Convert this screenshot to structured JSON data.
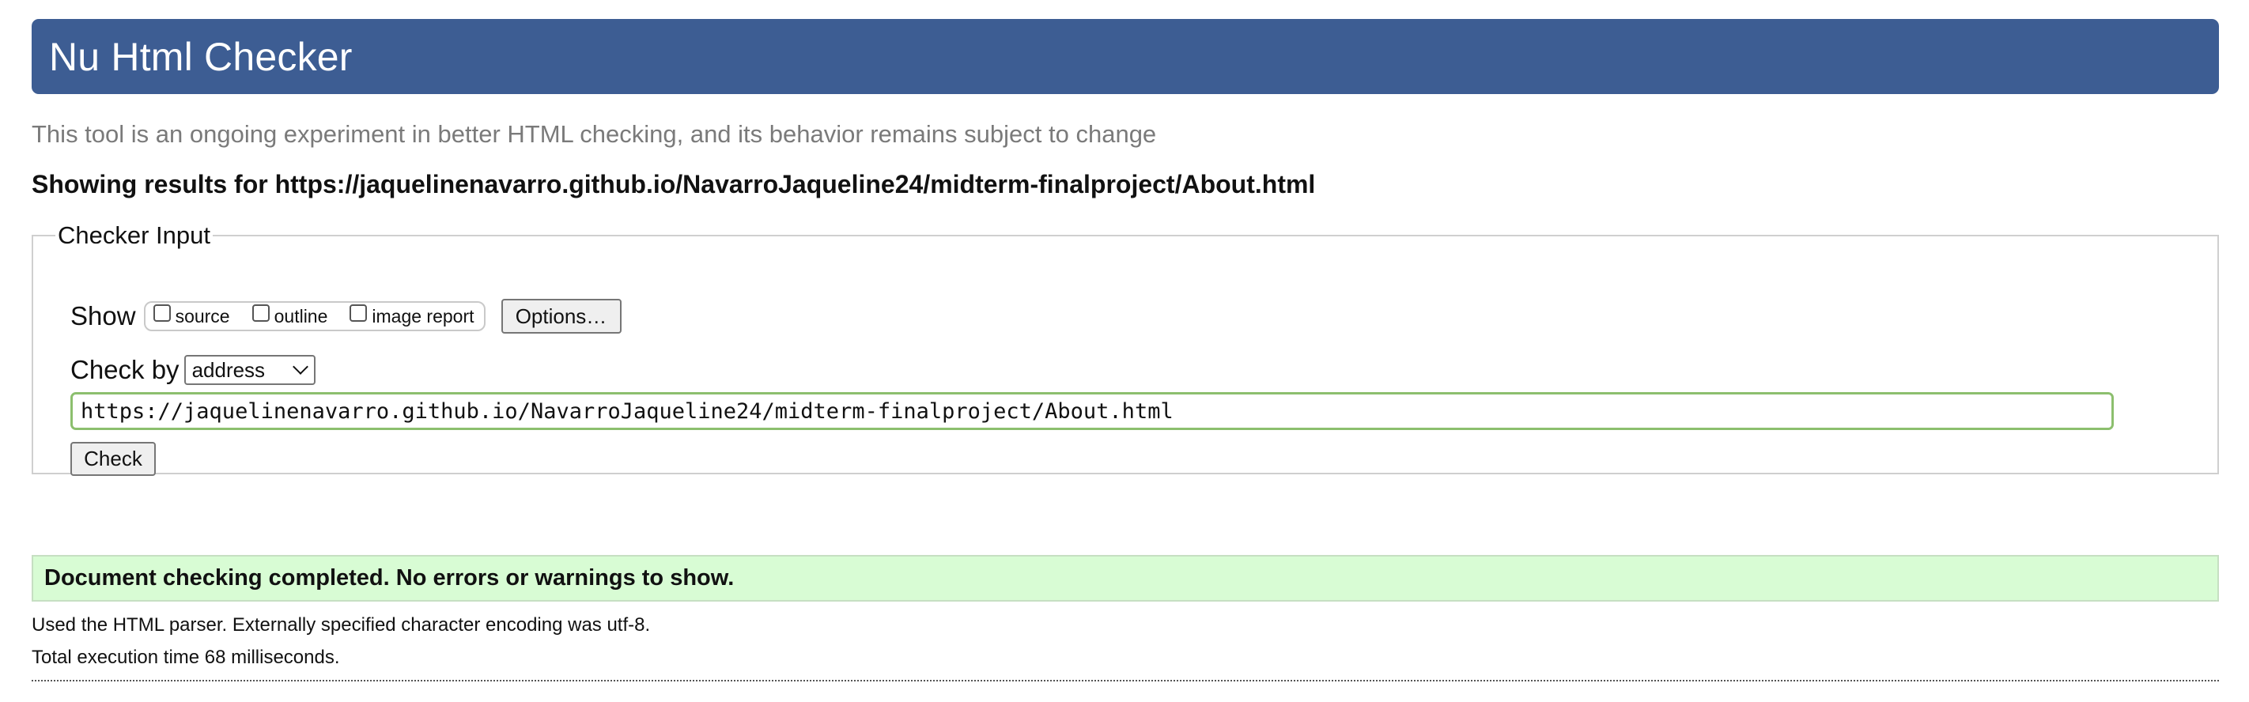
{
  "header": {
    "title": "Nu Html Checker"
  },
  "tagline": "This tool is an ongoing experiment in better HTML checking, and its behavior remains subject to change",
  "results_heading": "Showing results for https://jaquelinenavarro.github.io/NavarroJaqueline24/midterm-finalproject/About.html",
  "checker": {
    "legend": "Checker Input",
    "show_label": "Show",
    "options": [
      {
        "label": "source",
        "checked": false
      },
      {
        "label": "outline",
        "checked": false
      },
      {
        "label": "image report",
        "checked": false
      }
    ],
    "options_button": "Options…",
    "check_by_label": "Check by",
    "check_by_value": "address",
    "url_value": "https://jaquelinenavarro.github.io/NavarroJaqueline24/midterm-finalproject/About.html",
    "check_button": "Check"
  },
  "result": {
    "message": "Document checking completed. No errors or warnings to show.",
    "parser_info": "Used the HTML parser. Externally specified character encoding was utf-8.",
    "time_info": "Total execution time 68 milliseconds."
  },
  "colors": {
    "banner": "#3d5d93",
    "success_bg": "#d8fcd4",
    "input_border": "#8cbf6e"
  }
}
